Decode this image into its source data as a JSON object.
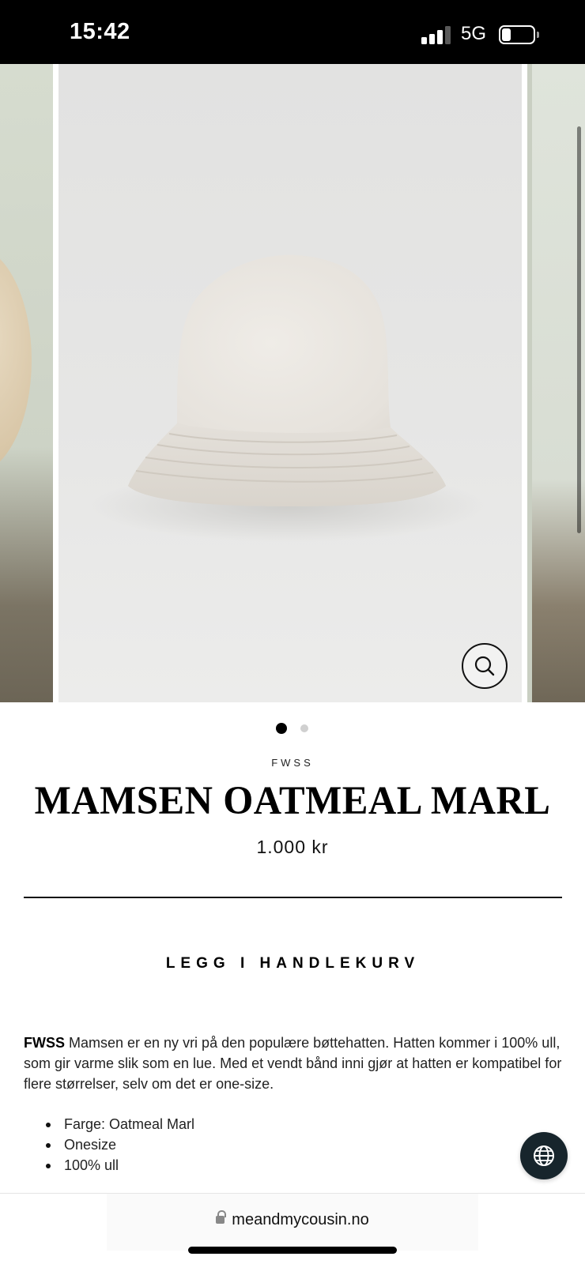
{
  "status_bar": {
    "time": "15:42",
    "network": "5G",
    "battery_level": 0.3,
    "signal_bars": 3
  },
  "carousel": {
    "current_slide": 1,
    "total_slides": 2,
    "zoom_icon": "magnifier-icon"
  },
  "product": {
    "brand": "FWSS",
    "title": "MAMSEN OATMEAL MARL",
    "price": "1.000 kr",
    "add_to_cart_label": "LEGG I HANDLEKURV",
    "description": {
      "brand_lead": "FWSS",
      "text": " Mamsen er en ny vri på den populære bøttehatten. Hatten kommer i 100% ull, som gir varme slik som en lue. Med et vendt bånd inni gjør at hatten er kompatibel for flere størrelser, selv om det er one-size."
    },
    "features": [
      "Farge: Oatmeal Marl",
      "Onesize",
      "100% ull"
    ]
  },
  "language_button": {
    "icon": "globe-icon"
  },
  "browser": {
    "url": "meandmycousin.no",
    "lock_icon": "lock-icon"
  },
  "colors": {
    "status_bar_bg": "#000000",
    "globe_button_bg": "#17252c",
    "hat_color": "#e8e4de"
  }
}
